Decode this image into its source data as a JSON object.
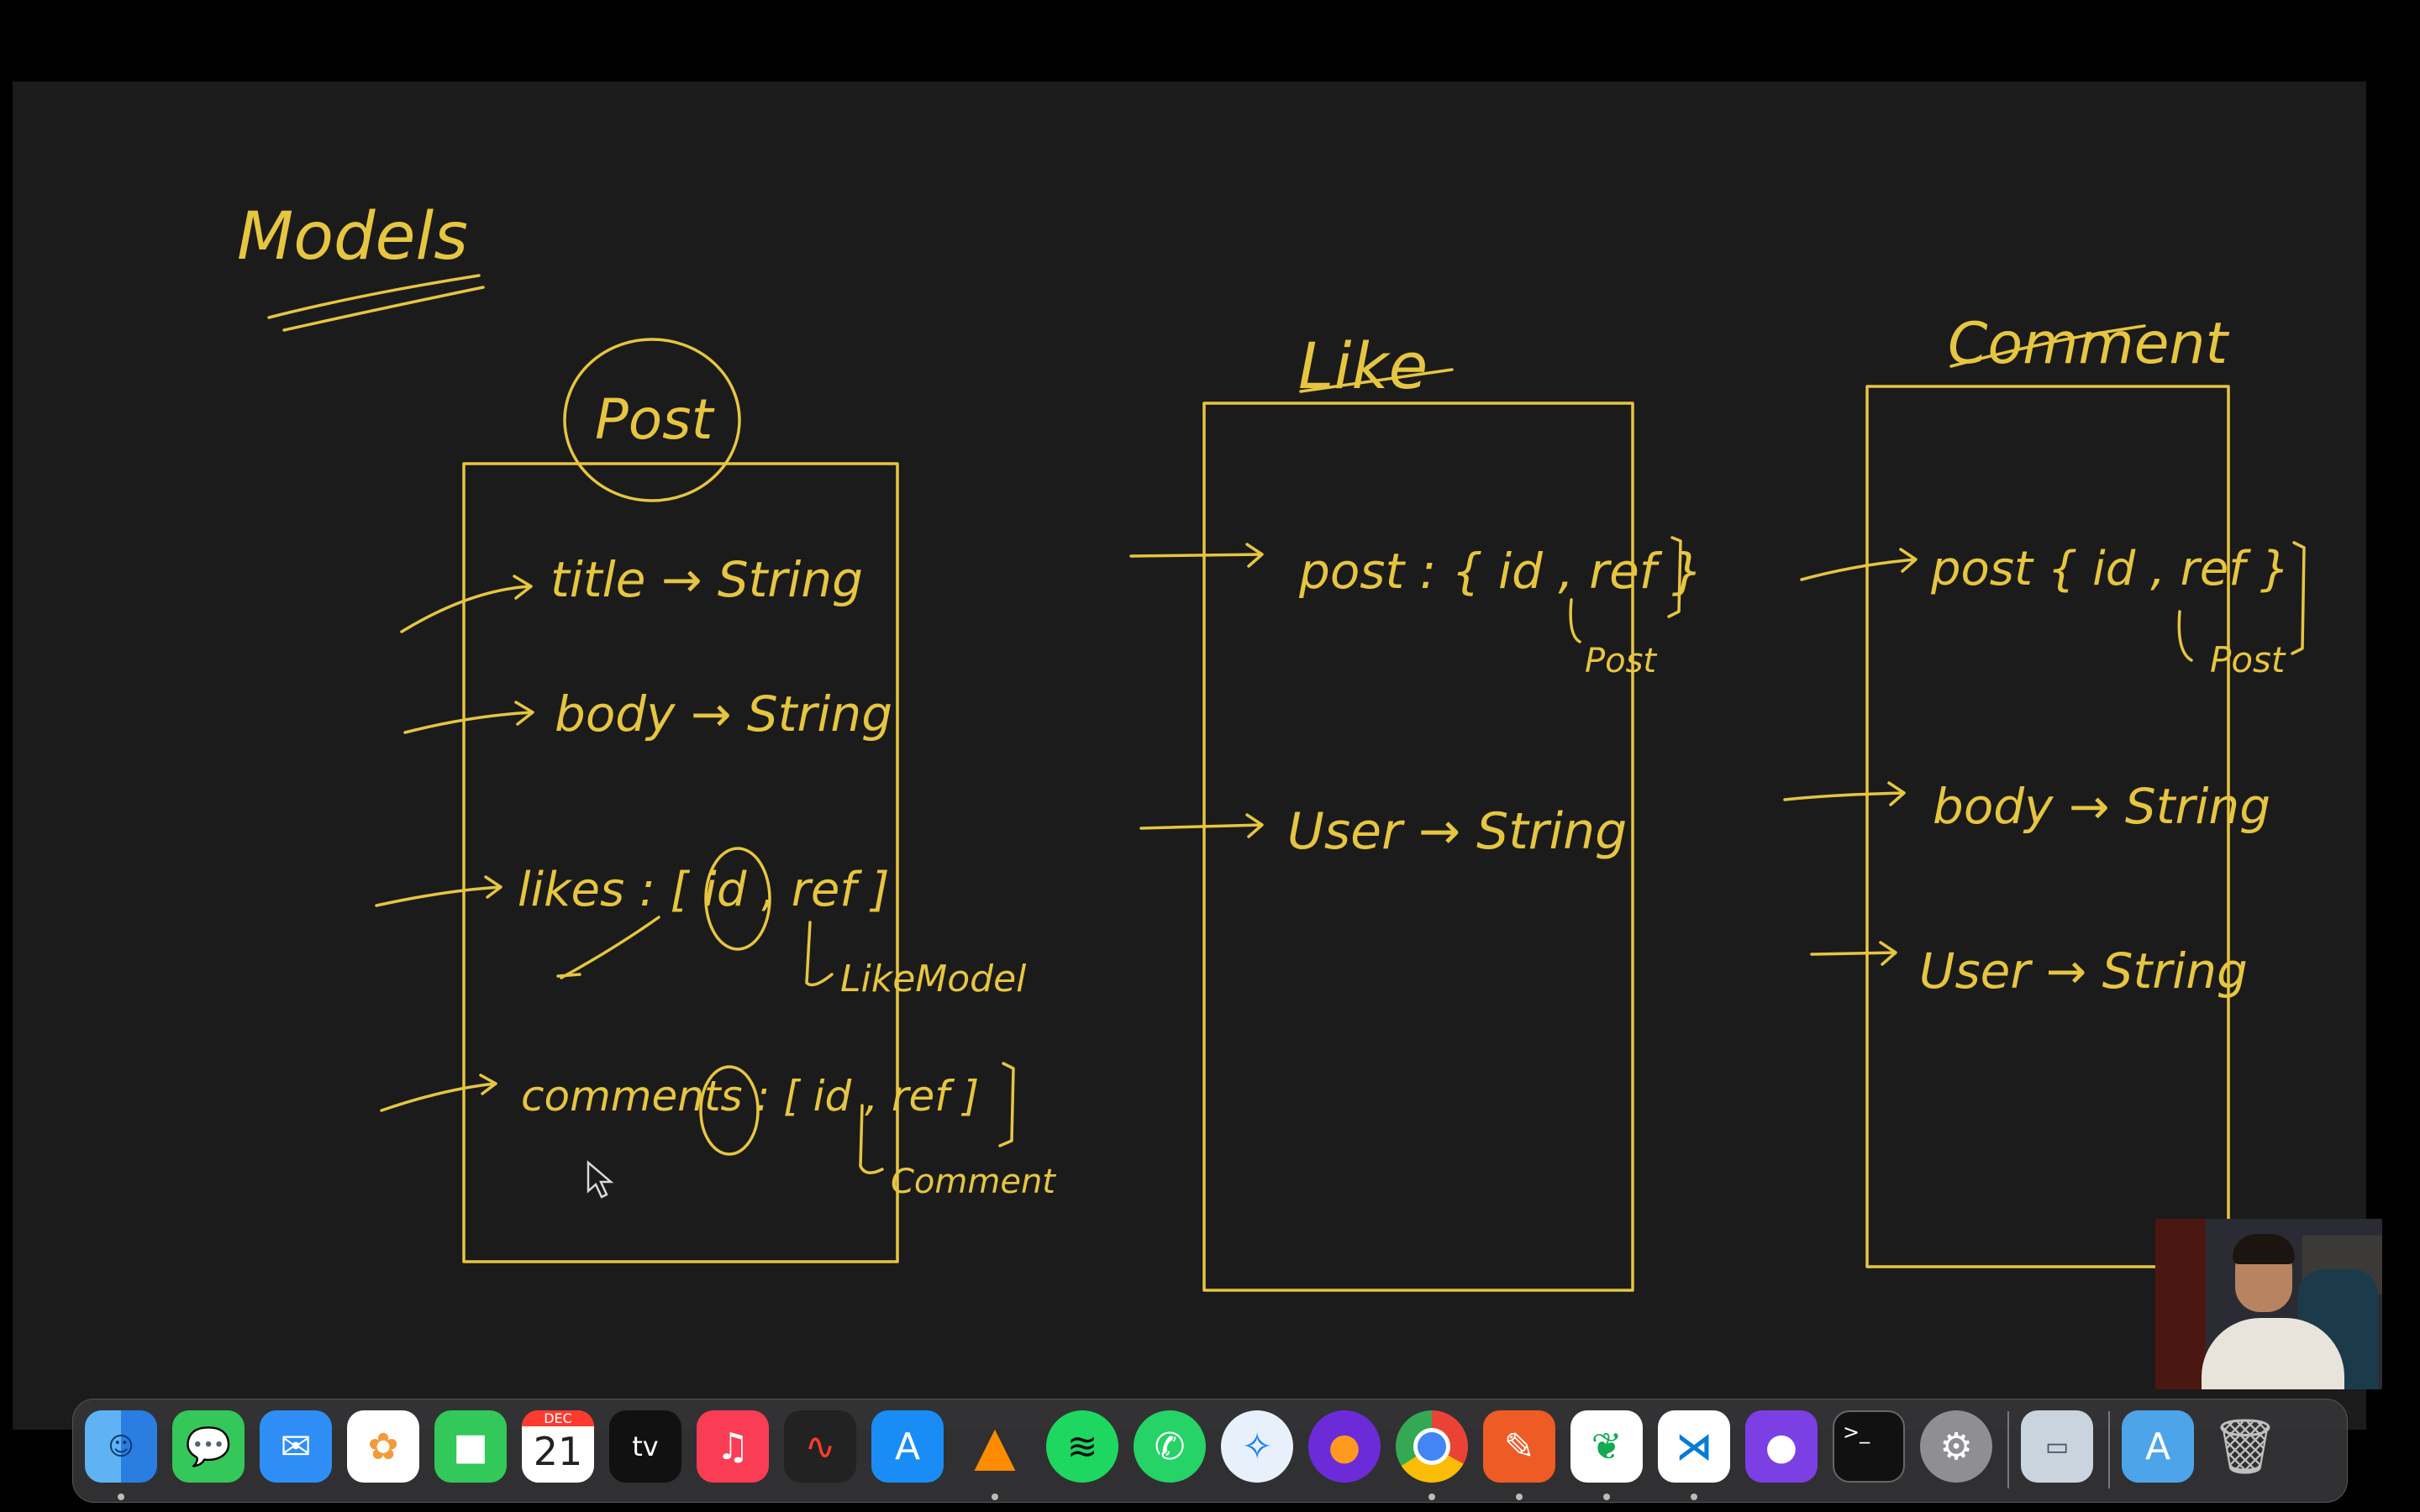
{
  "board": {
    "heading": "Models",
    "post_model": {
      "title": "Post",
      "fields": [
        "title → String",
        "body → String",
        "likes : [ id , ref ]",
        "comments : [ id , ref ]"
      ],
      "likes_ref_note": "LikeModel",
      "comments_ref_note": "Comment"
    },
    "like_model": {
      "title": "Like",
      "fields": [
        "post : { id , ref }",
        "User → String"
      ],
      "post_ref_note": "Post"
    },
    "comment_model": {
      "title": "Comment",
      "fields": [
        "post { id , ref }",
        "body → String",
        "User → String"
      ],
      "post_ref_note": "Post"
    },
    "ink_color": "#e6c541"
  },
  "dock": {
    "calendar_month": "DEC",
    "calendar_day": "21",
    "tv_label": "tv",
    "apps": [
      "finder-icon",
      "messages-icon",
      "mail-icon",
      "photos-icon",
      "facetime-icon",
      "calendar-icon",
      "apple-tv-icon",
      "music-icon",
      "voice-memos-icon",
      "app-store-icon",
      "vlc-icon",
      "spotify-icon",
      "whatsapp-icon",
      "safari-icon",
      "firefox-icon",
      "chrome-icon",
      "postman-icon",
      "mongodb-compass-icon",
      "vscode-icon",
      "github-desktop-icon",
      "terminal-icon",
      "system-preferences-icon",
      "preview-icon",
      "applications-folder-icon",
      "trash-icon"
    ]
  }
}
